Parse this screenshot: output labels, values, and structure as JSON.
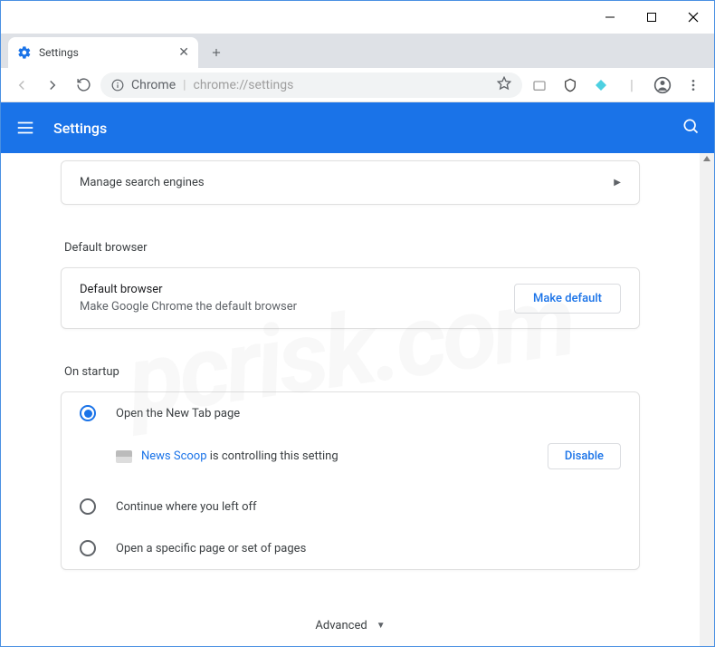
{
  "window": {
    "tab_title": "Settings",
    "address_label": "Chrome",
    "address_url": "chrome://settings"
  },
  "header": {
    "title": "Settings"
  },
  "search_engines": {
    "manage_label": "Manage search engines"
  },
  "default_browser": {
    "section_title": "Default browser",
    "primary": "Default browser",
    "secondary": "Make Google Chrome the default browser",
    "button": "Make default"
  },
  "startup": {
    "section_title": "On startup",
    "options": [
      "Open the New Tab page",
      "Continue where you left off",
      "Open a specific page or set of pages"
    ],
    "controlling_ext_name": "News Scoop",
    "controlling_text": "is controlling this setting",
    "disable_button": "Disable"
  },
  "advanced_label": "Advanced"
}
